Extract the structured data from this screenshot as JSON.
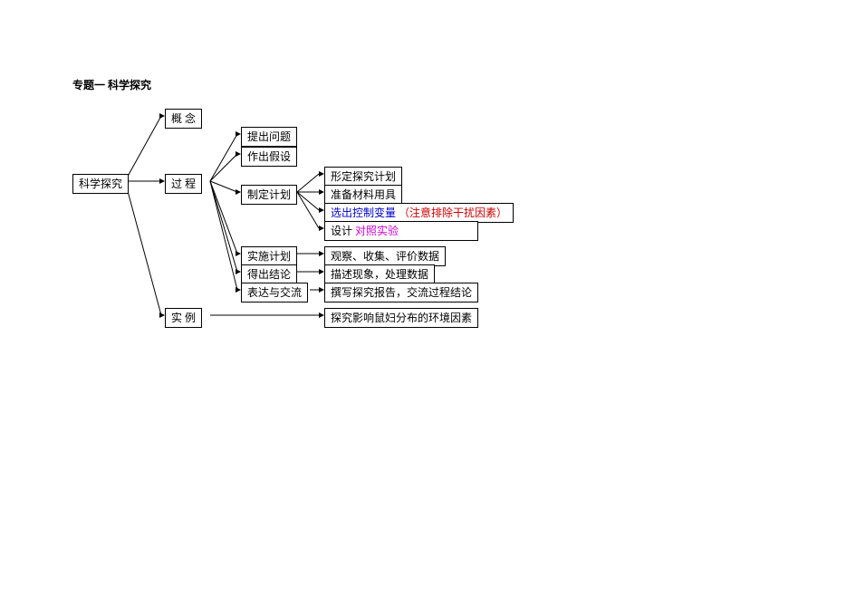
{
  "title": "专题一  科学探究",
  "root": "科学探究",
  "level1": {
    "concept": "概  念",
    "process": "过  程",
    "example": "实  例"
  },
  "process_steps": {
    "s1": "提出问题",
    "s2": "作出假设",
    "s3": "制定计划",
    "s4": "实施计划",
    "s5": "得出结论",
    "s6": "表达与交流"
  },
  "plan_items": {
    "p1": "形定探究计划",
    "p2": "准备材料用具",
    "p3_a": "选出控制变量",
    "p3_b": "（注意排除干扰因素）",
    "p4_a": "设计",
    "p4_b": "对照实验"
  },
  "right_items": {
    "r4": "观察、收集、评价数据",
    "r5": "描述现象，处理数据",
    "r6": "撰写探究报告，交流过程结论"
  },
  "example_item": "探究影响鼠妇分布的环境因素"
}
